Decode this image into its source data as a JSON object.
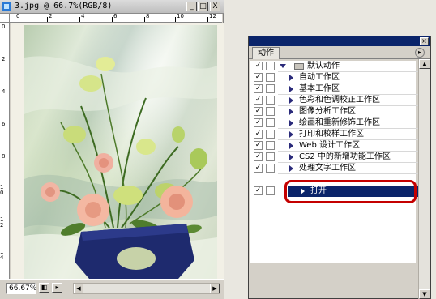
{
  "document": {
    "title": "3.jpg @ 66.7%(RGB/8)",
    "window_buttons": {
      "minimize": "_",
      "maximize": "□",
      "close": "X"
    },
    "ruler_top_numbers": [
      "0",
      "2",
      "4",
      "6",
      "8",
      "10",
      "12"
    ],
    "ruler_left_numbers": [
      "0",
      "2",
      "4",
      "6",
      "8",
      "1 0",
      "1 2",
      "1 4"
    ],
    "zoom": "66.67%"
  },
  "actions_panel": {
    "tab_label": "动作",
    "menu_icon": "▸",
    "set_name": "默认动作",
    "actions": [
      "自动工作区",
      "基本工作区",
      "色彩和色调校正工作区",
      "图像分析工作区",
      "绘画和重新修饰工作区",
      "打印和校样工作区",
      "Web 设计工作区",
      "CS2 中的新增功能工作区",
      "处理文字工作区"
    ],
    "selected_action": "打开",
    "check_mark": "✓",
    "colors": {
      "selection": "#0a246a",
      "highlight_ring": "#c40000"
    }
  }
}
